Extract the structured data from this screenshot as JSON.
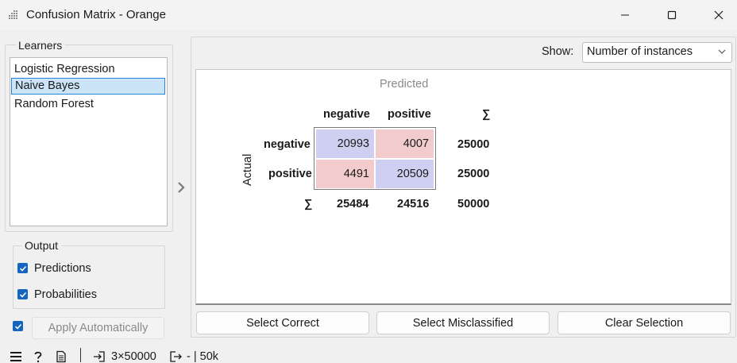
{
  "window": {
    "title": "Confusion Matrix - Orange"
  },
  "learners": {
    "title": "Learners",
    "items": [
      "Logistic Regression",
      "Naive Bayes",
      "Random Forest"
    ],
    "selected": "Naive Bayes"
  },
  "output": {
    "title": "Output",
    "predictions_label": "Predictions",
    "predictions_checked": true,
    "probabilities_label": "Probabilities",
    "probabilities_checked": true,
    "apply_auto_checked": true,
    "apply_label": "Apply Automatically"
  },
  "show": {
    "label": "Show:",
    "value": "Number of instances"
  },
  "matrix": {
    "predicted_label": "Predicted",
    "actual_label": "Actual",
    "sigma": "∑",
    "classes": [
      "negative",
      "positive"
    ],
    "cells": [
      [
        "20993",
        "4007"
      ],
      [
        "4491",
        "20509"
      ]
    ],
    "row_totals": [
      "25000",
      "25000"
    ],
    "col_totals": [
      "25484",
      "24516"
    ],
    "grand_total": "50000",
    "colors": {
      "correct": "#cfcff2",
      "incorrect": "#f2cccc"
    }
  },
  "buttons": {
    "select_correct": "Select Correct",
    "select_misclassified": "Select Misclassified",
    "clear_selection": "Clear Selection"
  },
  "status": {
    "input": "3×50000",
    "output": "- | 50k"
  }
}
